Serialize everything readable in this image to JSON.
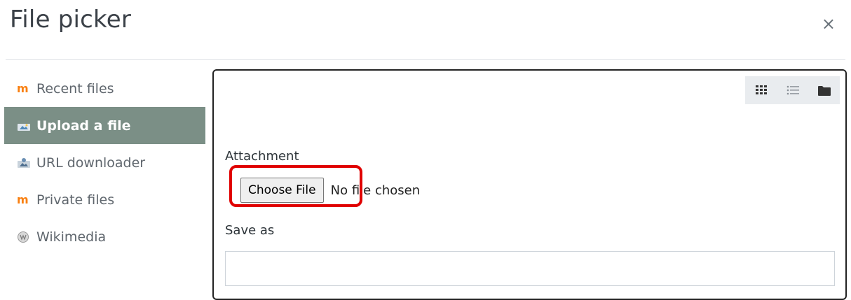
{
  "dialog": {
    "title": "File picker",
    "close_label": "×"
  },
  "sidebar": {
    "items": [
      {
        "label": "Recent files",
        "icon": "moodle-icon",
        "active": false
      },
      {
        "label": "Upload a file",
        "icon": "upload-icon",
        "active": true
      },
      {
        "label": "URL downloader",
        "icon": "url-downloader-icon",
        "active": false
      },
      {
        "label": "Private files",
        "icon": "moodle-icon",
        "active": false
      },
      {
        "label": "Wikimedia",
        "icon": "wikimedia-icon",
        "active": false
      }
    ]
  },
  "view_toggles": [
    {
      "icon": "grid-view-icon"
    },
    {
      "icon": "list-view-icon"
    },
    {
      "icon": "folder-view-icon"
    }
  ],
  "form": {
    "attachment_label": "Attachment",
    "choose_button_label": "Choose File",
    "no_file_text": "No file chosen",
    "saveas_label": "Save as",
    "saveas_value": ""
  },
  "colors": {
    "active_bg": "#7b8f86",
    "highlight": "#e00000",
    "moodle_orange": "#f98012"
  }
}
